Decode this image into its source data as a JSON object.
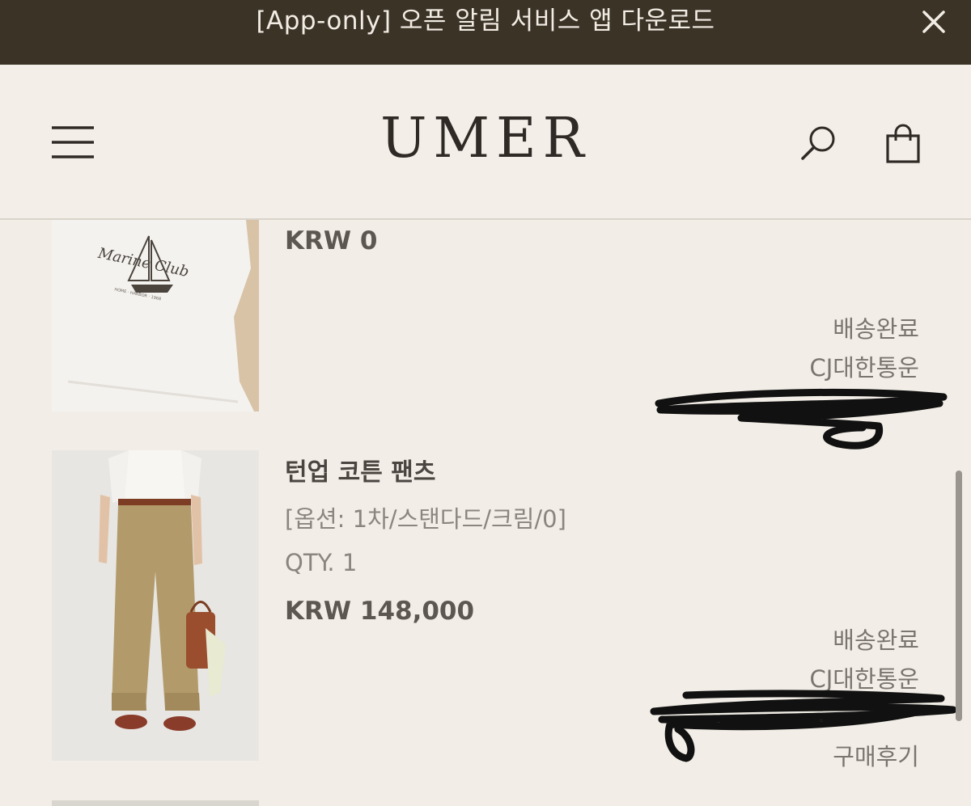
{
  "banner": {
    "text": "[App-only] 오픈 알림 서비스 앱 다운로드",
    "close_icon": "close-icon"
  },
  "header": {
    "logo": "UMER",
    "menu_icon": "hamburger-menu-icon",
    "search_icon": "search-icon",
    "cart_icon": "shopping-bag-icon"
  },
  "orders": [
    {
      "price": "KRW 0",
      "status": "배송완료",
      "carrier": "CJ대한통운"
    },
    {
      "name": "턴업 코튼 팬츠",
      "option": "[옵션: 1차/스탠다드/크림/0]",
      "qty": "QTY. 1",
      "price": "KRW 148,000",
      "status": "배송완료",
      "carrier": "CJ대한통운",
      "review": "구매후기"
    }
  ],
  "colors": {
    "banner_bg": "#3c3327",
    "page_bg": "#f2eee7",
    "text_dark": "#4a4540"
  }
}
